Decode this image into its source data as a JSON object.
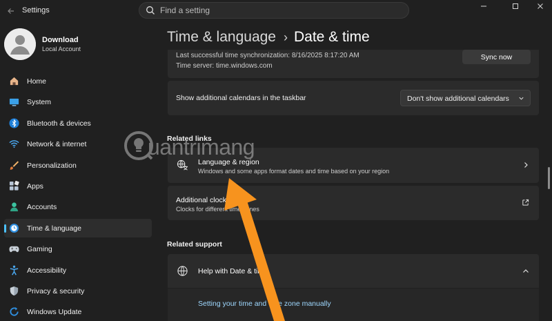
{
  "window": {
    "app_title": "Settings",
    "search_placeholder": "Find a setting"
  },
  "profile": {
    "name": "Download",
    "account_type": "Local Account"
  },
  "nav": {
    "items": [
      {
        "label": "Home",
        "icon": "home-icon"
      },
      {
        "label": "System",
        "icon": "system-icon"
      },
      {
        "label": "Bluetooth & devices",
        "icon": "bluetooth-icon"
      },
      {
        "label": "Network & internet",
        "icon": "wifi-icon"
      },
      {
        "label": "Personalization",
        "icon": "brush-icon"
      },
      {
        "label": "Apps",
        "icon": "apps-icon"
      },
      {
        "label": "Accounts",
        "icon": "accounts-icon"
      },
      {
        "label": "Time & language",
        "icon": "time-language-icon"
      },
      {
        "label": "Gaming",
        "icon": "gaming-icon"
      },
      {
        "label": "Accessibility",
        "icon": "accessibility-icon"
      },
      {
        "label": "Privacy & security",
        "icon": "shield-icon"
      },
      {
        "label": "Windows Update",
        "icon": "update-icon"
      }
    ],
    "active": "Time & language"
  },
  "breadcrumb": {
    "parent": "Time & language",
    "separator": "›",
    "current": "Date & time"
  },
  "sync": {
    "last_sync": "Last successful time synchronization: 8/16/2025 8:17:20 AM",
    "time_server": "Time server: time.windows.com",
    "sync_button": "Sync now"
  },
  "calendars": {
    "label": "Show additional calendars in the taskbar",
    "selected": "Don't show additional calendars"
  },
  "related_links": {
    "heading": "Related links",
    "language_region": {
      "title": "Language & region",
      "subtitle": "Windows and some apps format dates and time based on your region"
    },
    "additional_clocks": {
      "title": "Additional clocks",
      "subtitle": "Clocks for different time zones"
    }
  },
  "related_support": {
    "heading": "Related support",
    "help_title": "Help with Date & time",
    "link": "Setting your time and time zone manually"
  },
  "watermark": {
    "text": "uantrimang"
  },
  "colors": {
    "accent": "#4cc2ff",
    "annotation_arrow": "#f7931e",
    "background": "#202020",
    "card": "#2b2b2b"
  }
}
